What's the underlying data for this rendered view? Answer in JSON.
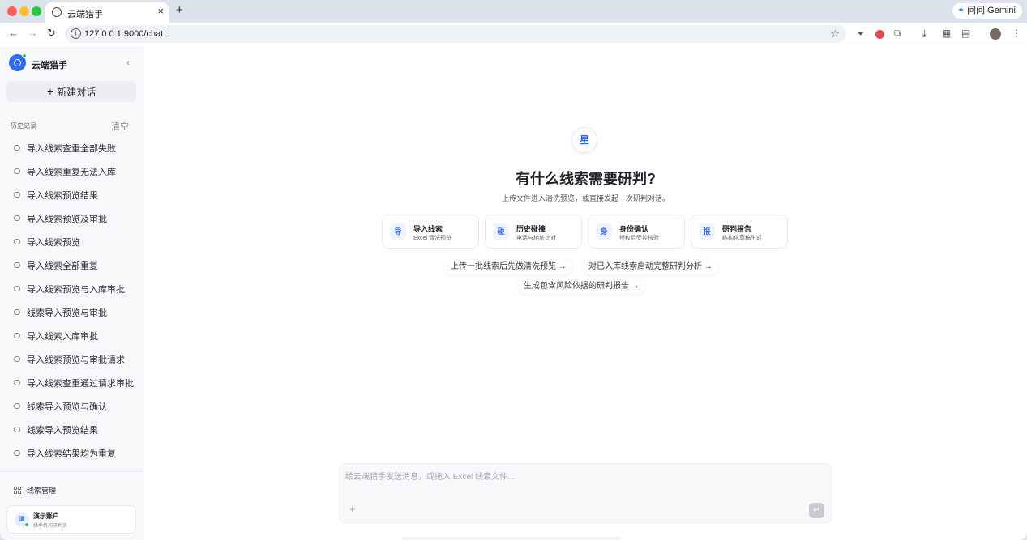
{
  "browser": {
    "tab_title": "云端猎手",
    "url": "127.0.0.1:9000/chat",
    "gemini_label": "问问 Gemini"
  },
  "sidebar": {
    "app_name": "云端猎手",
    "new_chat_label": "新建对话",
    "history_label": "历史记录",
    "clear_label": "清空",
    "history": [
      "导入线索查重全部失败",
      "导入线索重复无法入库",
      "导入线索预览结果",
      "导入线索预览及审批",
      "导入线索预览",
      "导入线索全部重复",
      "导入线索预览与入库审批",
      "线索导入预览与审批",
      "导入线索入库审批",
      "导入线索预览与审批请求",
      "导入线索查重通过请求审批",
      "线索导入预览与确认",
      "线索导入预览结果",
      "导入线索结果均为重复"
    ],
    "leads_management": "线索管理",
    "account": {
      "avatar_char": "演",
      "name": "演示账户",
      "role": "猎手机构研判员"
    }
  },
  "main": {
    "hero_icon_char": "星",
    "title": "有什么线索需要研判?",
    "subtitle": "上传文件进入清洗预览，或直接发起一次研判对话。",
    "cards": [
      {
        "icon": "导",
        "title": "导入线索",
        "subtitle": "Excel 清洗预览"
      },
      {
        "icon": "碰",
        "title": "历史碰撞",
        "subtitle": "电话与地址比对"
      },
      {
        "icon": "身",
        "title": "身份确认",
        "subtitle": "授权后受控核验"
      },
      {
        "icon": "报",
        "title": "研判报告",
        "subtitle": "结构化草稿生成"
      }
    ],
    "suggestions": [
      "上传一批线索后先做清洗预览 →",
      "对已入库线索启动完整研判分析 →",
      "生成包含风险依据的研判报告 →"
    ],
    "composer_placeholder": "给云端猎手发送消息，或拖入 Excel 线索文件..."
  },
  "colors": {
    "accent": "#2f6bff",
    "online": "#22c55e"
  }
}
